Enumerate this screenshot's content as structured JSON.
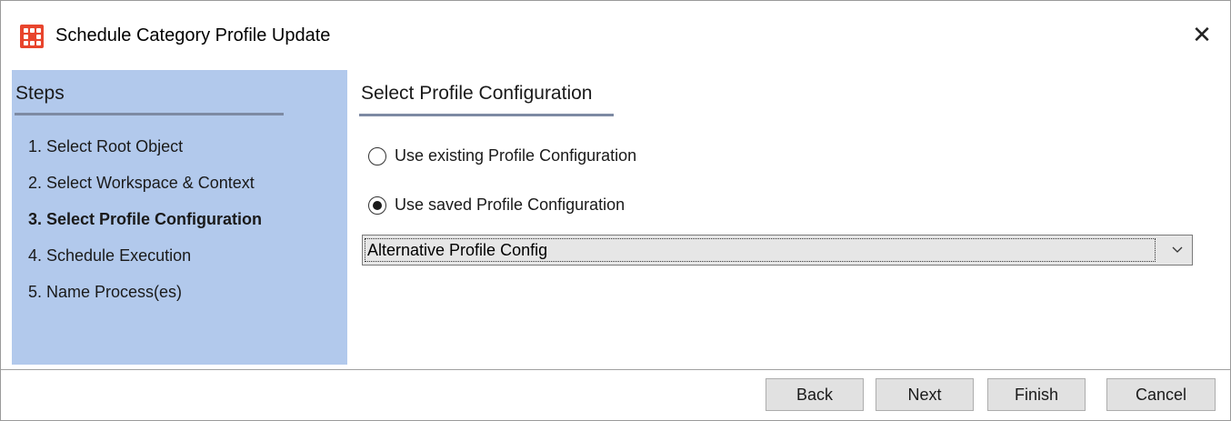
{
  "window": {
    "title": "Schedule Category Profile Update",
    "app_icon": "app-logo-icon",
    "close_glyph": "✕"
  },
  "steps": {
    "heading": "Steps",
    "items": [
      {
        "label": "1. Select Root Object",
        "active": false
      },
      {
        "label": "2. Select Workspace & Context",
        "active": false
      },
      {
        "label": "3. Select Profile Configuration",
        "active": true
      },
      {
        "label": "4. Schedule Execution",
        "active": false
      },
      {
        "label": "5. Name Process(es)",
        "active": false
      }
    ]
  },
  "main": {
    "section_title": "Select Profile Configuration",
    "options": [
      {
        "label": "Use existing Profile Configuration",
        "selected": false
      },
      {
        "label": "Use saved Profile Configuration",
        "selected": true
      }
    ],
    "saved_config_dropdown": {
      "value": "Alternative Profile Config"
    }
  },
  "footer": {
    "back_label": "Back",
    "next_label": "Next",
    "finish_label": "Finish",
    "cancel_label": "Cancel"
  },
  "colors": {
    "steps_panel_bg": "#b2c9ec",
    "app_icon_bg": "#e8452d",
    "underline": "#7d8aa3"
  }
}
